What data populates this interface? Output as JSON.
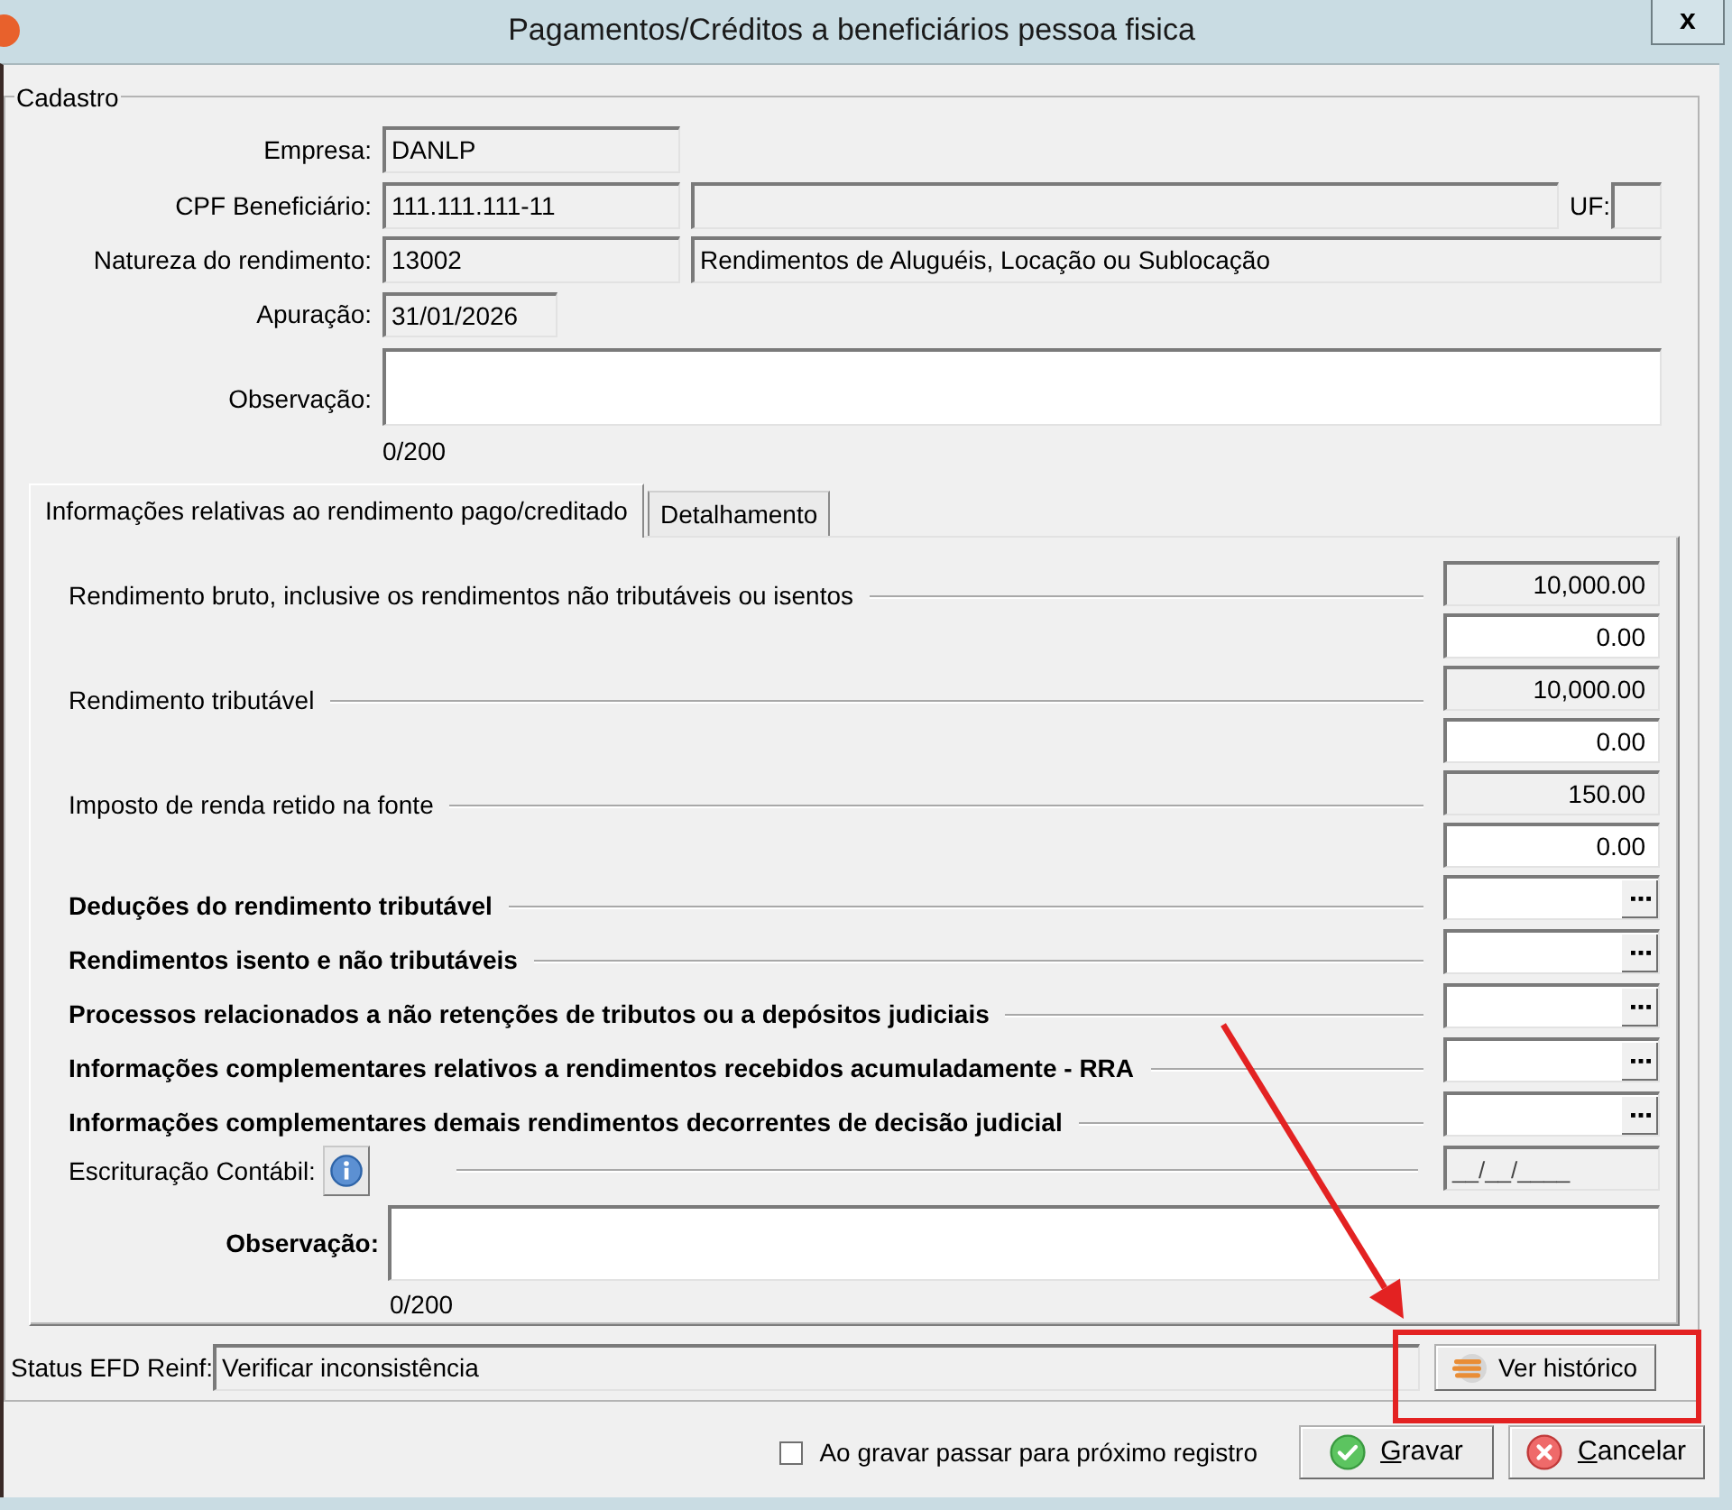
{
  "window": {
    "title": "Pagamentos/Créditos a beneficiários pessoa fisica",
    "close": "x"
  },
  "cadastro": {
    "legend": "Cadastro",
    "empresa": {
      "label": "Empresa:",
      "field": {
        "value": "DANLP",
        "readonly": true
      }
    },
    "cpf": {
      "label": "CPF Beneficiário:",
      "field": {
        "value": "111.111.111-11",
        "readonly": true
      },
      "name_field": {
        "readonly": true
      },
      "uf_label": "UF:",
      "uf_field": {
        "readonly": true
      }
    },
    "natureza": {
      "label": "Natureza do rendimento:",
      "code_field": {
        "value": "13002",
        "readonly": true
      },
      "description_field": {
        "value": "Rendimentos de Aluguéis, Locação ou Sublocação",
        "readonly": true
      }
    },
    "apuracao": {
      "label": "Apuração:",
      "field": {
        "value": "31/01/2026",
        "readonly": true
      }
    },
    "observacao": {
      "label": "Observação:",
      "field": {
        "readonly": false
      },
      "counter": "0/200"
    }
  },
  "tabs": [
    {
      "label": "Informações relativas ao rendimento pago/creditado",
      "selected": true
    },
    {
      "label": "Detalhamento",
      "selected": false
    }
  ],
  "rendimento": {
    "rows": [
      {
        "kind": "amount",
        "label": "Rendimento bruto, inclusive os rendimentos não tributáveis ou isentos",
        "fields": [
          {
            "value": "10,000.00",
            "readonly": true
          },
          {
            "value": "0.00",
            "readonly": false
          }
        ]
      },
      {
        "kind": "amount",
        "label": "Rendimento tributável",
        "fields": [
          {
            "value": "10,000.00",
            "readonly": true
          },
          {
            "value": "0.00",
            "readonly": false
          }
        ]
      },
      {
        "kind": "amount",
        "label": "Imposto de renda retido na fonte",
        "fields": [
          {
            "value": "150.00",
            "readonly": true
          },
          {
            "value": "0.00",
            "readonly": false
          }
        ]
      },
      {
        "kind": "lookup",
        "label": "Deduções do rendimento tributável",
        "field": {
          "readonly": false
        }
      },
      {
        "kind": "lookup",
        "label": "Rendimentos isento e não tributáveis",
        "field": {
          "readonly": false
        }
      },
      {
        "kind": "lookup",
        "label": "Processos relacionados a não retenções de tributos ou a depósitos judiciais",
        "field": {
          "readonly": false
        }
      },
      {
        "kind": "lookup",
        "label": "Informações complementares relativos a rendimentos recebidos acumuladamente - RRA",
        "field": {
          "readonly": false
        }
      },
      {
        "kind": "lookup",
        "label": "Informações complementares demais rendimentos decorrentes de decisão judicial",
        "field": {
          "readonly": false
        }
      },
      {
        "kind": "date",
        "label": "Escrituração Contábil:",
        "field": {
          "value": "__/__/____",
          "readonly": true
        }
      }
    ],
    "observacao": {
      "label": "Observação:",
      "field": {
        "readonly": false
      },
      "counter": "0/200"
    }
  },
  "status": {
    "label": "Status EFD Reinf:",
    "field": {
      "value": "Verificar inconsistência",
      "readonly": true
    },
    "button": "Ver histórico"
  },
  "footer": {
    "next_record": {
      "label": "Ao gravar passar para próximo registro",
      "checked": false
    },
    "buttons": [
      {
        "kind": "save",
        "label": "Gravar",
        "mnemonic_underlined": true
      },
      {
        "kind": "cancel",
        "label": "Cancelar",
        "mnemonic_underlined": true
      }
    ]
  }
}
